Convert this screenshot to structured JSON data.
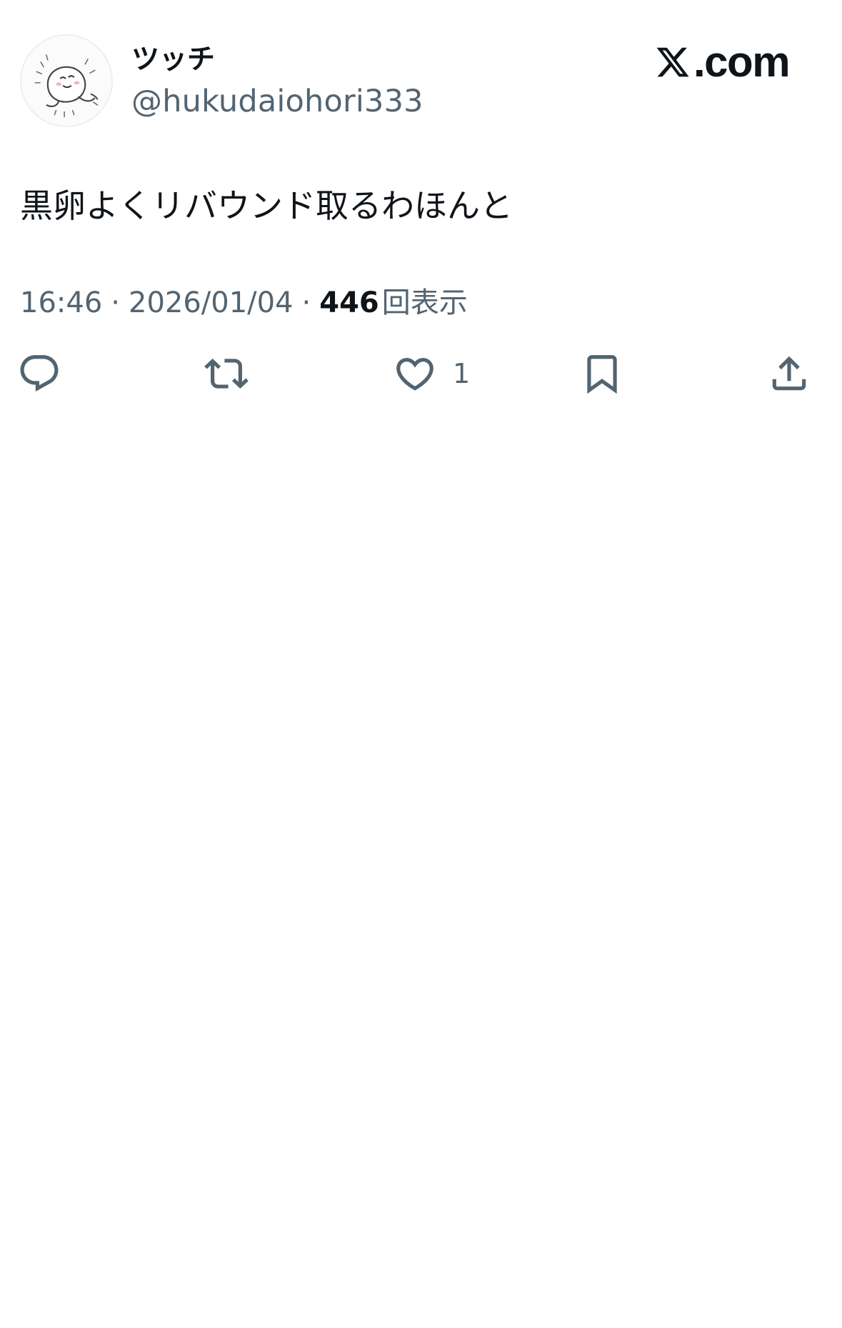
{
  "tweet": {
    "display_name": "ツッチ",
    "handle": "@hukudaiohori333",
    "text": "黒卵よくリバウンド取るわほんと",
    "time": "16:46",
    "date": "2026/01/04",
    "separator": "·",
    "views_count": "446",
    "views_label": "回表示"
  },
  "brand": {
    "text": ".com",
    "icon": "x-logo-icon"
  },
  "actions": {
    "reply": {
      "icon": "reply-icon"
    },
    "repost": {
      "icon": "repost-icon"
    },
    "like": {
      "icon": "heart-icon",
      "count": "1"
    },
    "bookmark": {
      "icon": "bookmark-icon"
    },
    "share": {
      "icon": "share-icon"
    }
  },
  "colors": {
    "text_primary": "#0f1419",
    "text_secondary": "#536471",
    "background": "#ffffff"
  }
}
